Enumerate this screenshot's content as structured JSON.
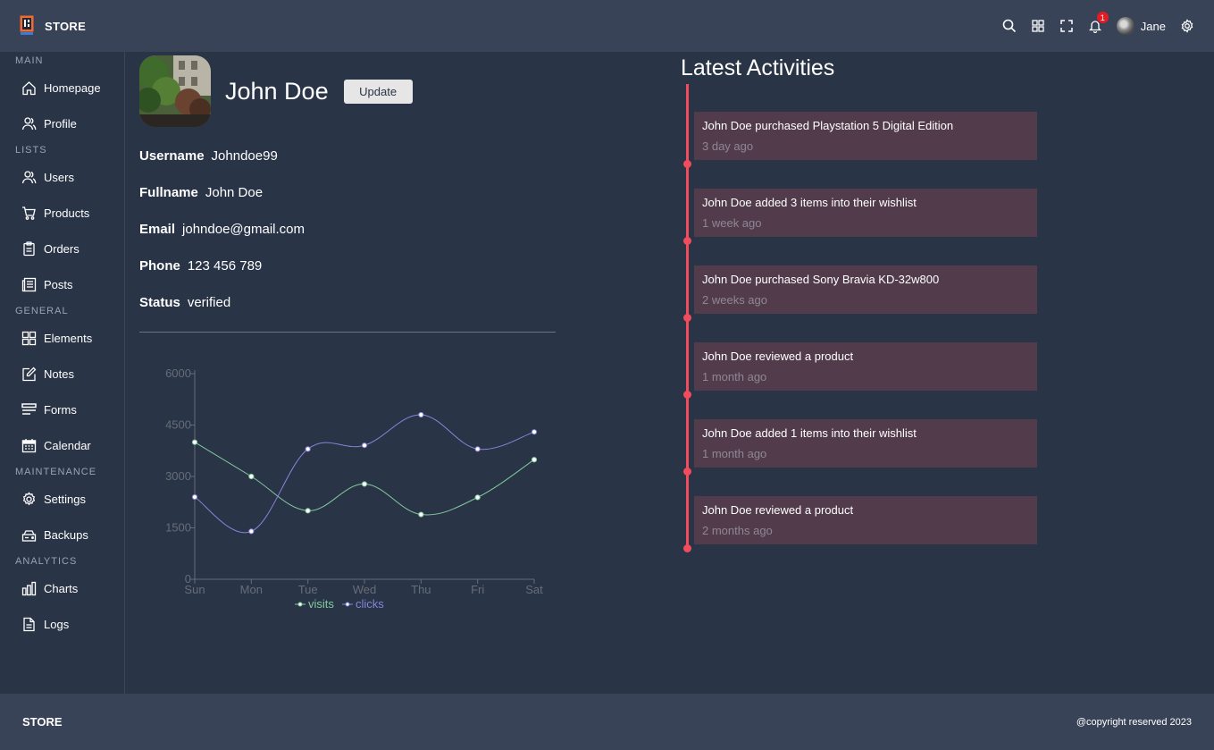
{
  "brand": {
    "name": "STORE"
  },
  "topbar": {
    "notification_count": "1",
    "user_name": "Jane"
  },
  "sidebar": {
    "sections": [
      {
        "title": "MAIN",
        "items": [
          {
            "label": "Homepage",
            "icon": "home-icon"
          },
          {
            "label": "Profile",
            "icon": "profile-icon"
          }
        ]
      },
      {
        "title": "LISTS",
        "items": [
          {
            "label": "Users",
            "icon": "users-icon"
          },
          {
            "label": "Products",
            "icon": "cart-icon"
          },
          {
            "label": "Orders",
            "icon": "clipboard-icon"
          },
          {
            "label": "Posts",
            "icon": "posts-icon"
          }
        ]
      },
      {
        "title": "GENERAL",
        "items": [
          {
            "label": "Elements",
            "icon": "grid-icon"
          },
          {
            "label": "Notes",
            "icon": "note-icon"
          },
          {
            "label": "Forms",
            "icon": "forms-icon"
          },
          {
            "label": "Calendar",
            "icon": "calendar-icon"
          }
        ]
      },
      {
        "title": "MAINTENANCE",
        "items": [
          {
            "label": "Settings",
            "icon": "gear-icon"
          },
          {
            "label": "Backups",
            "icon": "backup-icon"
          }
        ]
      },
      {
        "title": "ANALYTICS",
        "items": [
          {
            "label": "Charts",
            "icon": "chart-icon"
          },
          {
            "label": "Logs",
            "icon": "log-icon"
          }
        ]
      }
    ]
  },
  "profile": {
    "name": "John Doe",
    "update_label": "Update",
    "fields": [
      {
        "key": "Username",
        "value": "Johndoe99"
      },
      {
        "key": "Fullname",
        "value": "John Doe"
      },
      {
        "key": "Email",
        "value": "johndoe@gmail.com"
      },
      {
        "key": "Phone",
        "value": "123 456 789"
      },
      {
        "key": "Status",
        "value": "verified"
      }
    ]
  },
  "chart_data": {
    "type": "line",
    "categories": [
      "Sun",
      "Mon",
      "Tue",
      "Wed",
      "Thu",
      "Fri",
      "Sat"
    ],
    "series": [
      {
        "name": "visits",
        "color": "#82ca9d",
        "values": [
          4000,
          3000,
          2000,
          2780,
          1890,
          2390,
          3490
        ]
      },
      {
        "name": "clicks",
        "color": "#8884d8",
        "values": [
          2400,
          1398,
          3800,
          3908,
          4800,
          3800,
          4300
        ]
      }
    ],
    "yticks": [
      0,
      1500,
      3000,
      4500,
      6000
    ],
    "ylim": [
      0,
      6000
    ],
    "grid": false,
    "legend": "bottom"
  },
  "activities": {
    "title": "Latest Activities",
    "items": [
      {
        "text": "John Doe purchased Playstation 5 Digital Edition",
        "time": "3 day ago"
      },
      {
        "text": "John Doe added 3 items into their wishlist",
        "time": "1 week ago"
      },
      {
        "text": "John Doe purchased Sony Bravia KD-32w800",
        "time": "2 weeks ago"
      },
      {
        "text": "John Doe reviewed a product",
        "time": "1 month ago"
      },
      {
        "text": "John Doe added 1 items into their wishlist",
        "time": "1 month ago"
      },
      {
        "text": "John Doe reviewed a product",
        "time": "2 months ago"
      }
    ]
  },
  "footer": {
    "brand": "STORE",
    "copyright": "@copyright reserved 2023"
  }
}
